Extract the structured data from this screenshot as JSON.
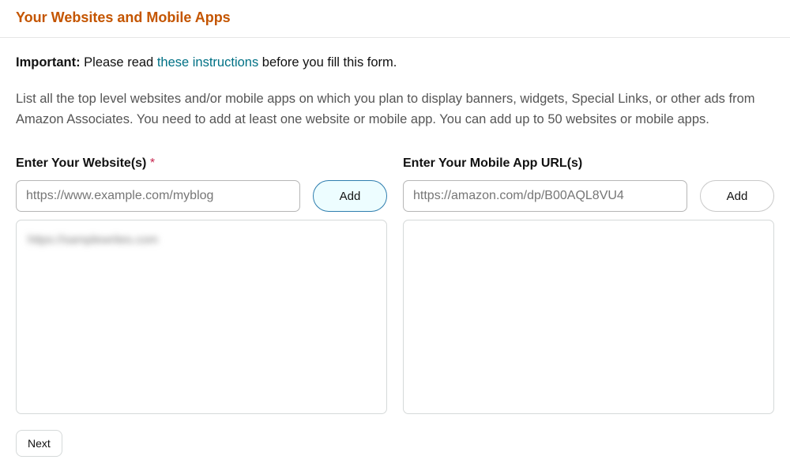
{
  "header": {
    "title": "Your Websites and Mobile Apps"
  },
  "notice": {
    "important_label": "Important:",
    "pre_link_text": " Please read ",
    "link_text": "these instructions",
    "post_link_text": " before you fill this form."
  },
  "description": "List all the top level websites and/or mobile apps on which you plan to display banners, widgets, Special Links, or other ads from Amazon Associates. You need to add at least one website or mobile app. You can add up to 50 websites or mobile apps.",
  "websites": {
    "label": "Enter Your Website(s)",
    "required_mark": "*",
    "placeholder": "https://www.example.com/myblog",
    "add_label": "Add",
    "entries": [
      "https://samplewrites.com"
    ]
  },
  "apps": {
    "label": "Enter Your Mobile App URL(s)",
    "placeholder": "https://amazon.com/dp/B00AQL8VU4",
    "add_label": "Add"
  },
  "footer": {
    "next_label": "Next"
  }
}
